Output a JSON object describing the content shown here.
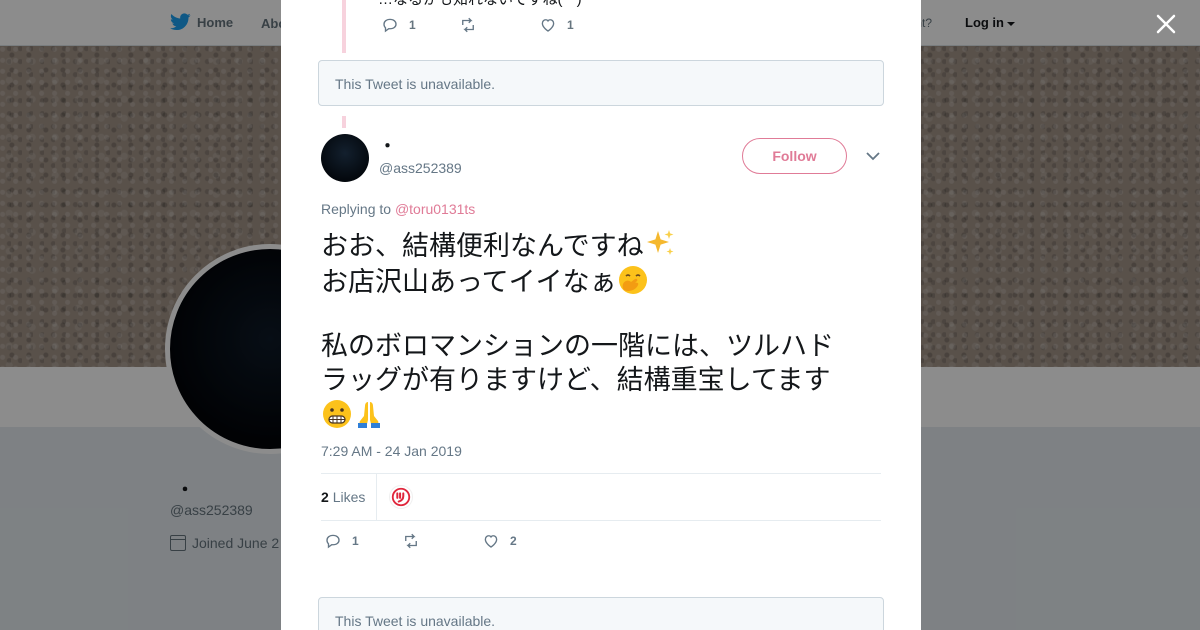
{
  "topbar": {
    "home_label": "Home",
    "about_label": "Abo",
    "account_prompt": "ccount?",
    "login_label": "Log in"
  },
  "profile": {
    "name": "・",
    "handle": "@ass252389",
    "joined": "Joined June 2"
  },
  "previous_tweet": {
    "text_fragment": "…なるかも知れないですね(^^)",
    "reply_count": "1",
    "like_count": "1"
  },
  "unavailable_notice_top": "This Tweet is unavailable.",
  "tweet": {
    "author_name": "・",
    "author_handle": "@ass252389",
    "follow_label": "Follow",
    "replying_prefix": "Replying to",
    "replying_to": "@toru0131ts",
    "line1": "おお、結構便利なんですね",
    "line2": "お店沢山あってイイなぁ",
    "line3": "私のボロマンションの一階には、ツルハド",
    "line4": "ラッグが有りますけど、結構重宝してます",
    "timestamp": "7:29 AM - 24 Jan 2019",
    "likes_number": "2",
    "likes_word": "Likes",
    "reply_count": "1",
    "like_count": "2"
  },
  "unavailable_notice_bottom": "This Tweet is unavailable.",
  "icons": {
    "bird": "twitter-bird-icon",
    "close": "close-icon",
    "reply": "reply-icon",
    "retweet": "retweet-icon",
    "like": "heart-icon",
    "more": "chevron-down-icon",
    "calendar": "calendar-icon"
  },
  "colors": {
    "accent": "#e07b97",
    "brand_blue": "#1da1f2",
    "muted": "#657786"
  }
}
